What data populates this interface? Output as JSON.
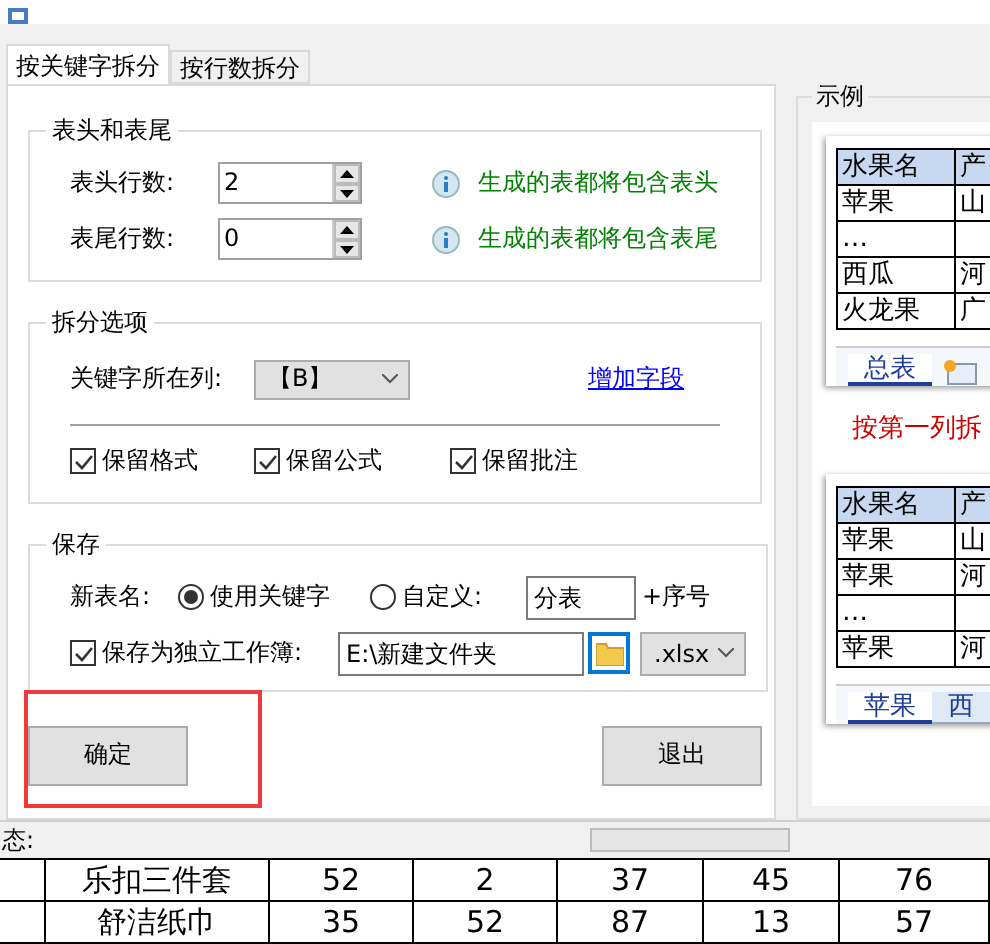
{
  "tabs": [
    {
      "label": "按关键字拆分",
      "selected": true
    },
    {
      "label": "按行数拆分",
      "selected": false
    }
  ],
  "header_footer": {
    "title": "表头和表尾",
    "rows": [
      {
        "label": "表头行数:",
        "value": "2",
        "hint": "生成的表都将包含表头"
      },
      {
        "label": "表尾行数:",
        "value": "0",
        "hint": "生成的表都将包含表尾"
      }
    ]
  },
  "split_options": {
    "title": "拆分选项",
    "key_column": {
      "label": "关键字所在列:",
      "value": "【B】"
    },
    "add_field_link": "增加字段",
    "checkboxes": [
      {
        "label": "保留格式",
        "checked": true
      },
      {
        "label": "保留公式",
        "checked": true
      },
      {
        "label": "保留批注",
        "checked": true
      }
    ]
  },
  "save": {
    "title": "保存",
    "new_name": {
      "label": "新表名:",
      "options": [
        {
          "label": "使用关键字",
          "selected": true
        },
        {
          "label": "自定义:",
          "selected": false
        }
      ],
      "custom_value": "分表",
      "suffix": "+序号"
    },
    "workbook": {
      "label": "保存为独立工作簿:",
      "checked": true,
      "path": "E:\\新建文件夹",
      "extension": ".xlsx"
    }
  },
  "buttons": [
    {
      "label": "确定"
    },
    {
      "label": "退出"
    }
  ],
  "example": {
    "title": "示例",
    "caption": "按第一列拆",
    "sheets": [
      {
        "header": [
          "水果名",
          "产"
        ],
        "rows": [
          [
            "苹果",
            "山"
          ],
          [
            "…",
            ""
          ],
          [
            "西瓜",
            "河"
          ],
          [
            "火龙果",
            "广"
          ]
        ],
        "tabs": [
          {
            "kind": "label",
            "label": "总表",
            "selected": true
          },
          {
            "kind": "insert"
          }
        ]
      },
      {
        "header": [
          "水果名",
          "产"
        ],
        "rows": [
          [
            "苹果",
            "山"
          ],
          [
            "苹果",
            "河"
          ],
          [
            "…",
            ""
          ],
          [
            "苹果",
            "河"
          ]
        ],
        "tabs": [
          {
            "kind": "label",
            "label": "苹果",
            "selected": true
          },
          {
            "kind": "label",
            "label": "西",
            "selected": false
          }
        ]
      }
    ]
  },
  "status": {
    "label": "态:",
    "progress": {
      "level": 0
    }
  },
  "sheet_rows": [
    [
      "乐扣三件套",
      "52",
      "2",
      "37",
      "45",
      "76"
    ],
    [
      "舒洁纸巾",
      "35",
      "52",
      "87",
      "13",
      "57"
    ]
  ]
}
